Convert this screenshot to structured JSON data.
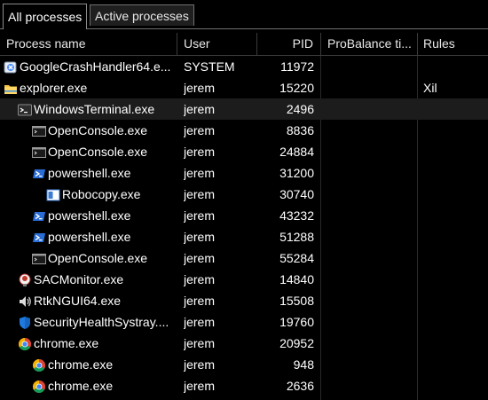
{
  "tabs": [
    {
      "label": "All processes",
      "active": true
    },
    {
      "label": "Active processes",
      "active": false
    }
  ],
  "columns": {
    "name": "Process name",
    "user": "User",
    "pid": "PID",
    "probalance": "ProBalance ti...",
    "rules": "Rules"
  },
  "rows": [
    {
      "name": "GoogleCrashHandler64.e...",
      "user": "SYSTEM",
      "pid": "11972",
      "rules": "",
      "icon": "crash-handler-icon",
      "indent": 0
    },
    {
      "name": "explorer.exe",
      "user": "jerem",
      "pid": "15220",
      "rules": "Xil",
      "icon": "folder-icon",
      "indent": 0
    },
    {
      "name": "WindowsTerminal.exe",
      "user": "jerem",
      "pid": "2496",
      "rules": "",
      "icon": "terminal-icon",
      "indent": 1
    },
    {
      "name": "OpenConsole.exe",
      "user": "jerem",
      "pid": "8836",
      "rules": "",
      "icon": "console-icon",
      "indent": 2
    },
    {
      "name": "OpenConsole.exe",
      "user": "jerem",
      "pid": "24884",
      "rules": "",
      "icon": "console-icon",
      "indent": 2
    },
    {
      "name": "powershell.exe",
      "user": "jerem",
      "pid": "31200",
      "rules": "",
      "icon": "powershell-icon",
      "indent": 2
    },
    {
      "name": "Robocopy.exe",
      "user": "jerem",
      "pid": "30740",
      "rules": "",
      "icon": "window-icon",
      "indent": 3
    },
    {
      "name": "powershell.exe",
      "user": "jerem",
      "pid": "43232",
      "rules": "",
      "icon": "powershell-icon",
      "indent": 2
    },
    {
      "name": "powershell.exe",
      "user": "jerem",
      "pid": "51288",
      "rules": "",
      "icon": "powershell-icon",
      "indent": 2
    },
    {
      "name": "OpenConsole.exe",
      "user": "jerem",
      "pid": "55284",
      "rules": "",
      "icon": "console-icon",
      "indent": 2
    },
    {
      "name": "SACMonitor.exe",
      "user": "jerem",
      "pid": "14840",
      "rules": "",
      "icon": "sac-monitor-icon",
      "indent": 1
    },
    {
      "name": "RtkNGUI64.exe",
      "user": "jerem",
      "pid": "15508",
      "rules": "",
      "icon": "realtek-audio-icon",
      "indent": 1
    },
    {
      "name": "SecurityHealthSystray....",
      "user": "jerem",
      "pid": "19760",
      "rules": "",
      "icon": "shield-icon",
      "indent": 1
    },
    {
      "name": "chrome.exe",
      "user": "jerem",
      "pid": "20952",
      "rules": "",
      "icon": "chrome-icon",
      "indent": 1
    },
    {
      "name": "chrome.exe",
      "user": "jerem",
      "pid": "948",
      "rules": "",
      "icon": "chrome-icon",
      "indent": 2
    },
    {
      "name": "chrome.exe",
      "user": "jerem",
      "pid": "2636",
      "rules": "",
      "icon": "chrome-icon",
      "indent": 2
    }
  ],
  "selected_row": 2
}
